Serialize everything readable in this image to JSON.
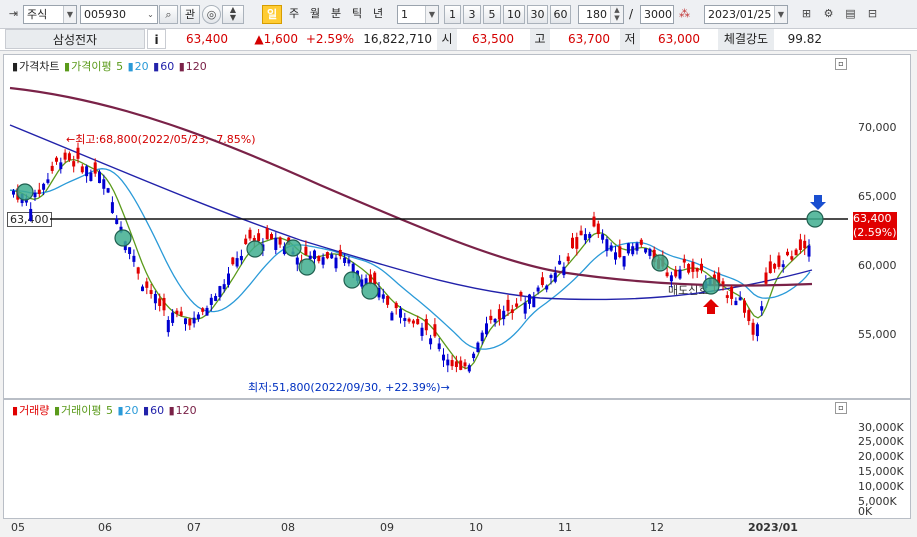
{
  "toolbar": {
    "market": "주식",
    "code": "005930",
    "kwan_label": "관",
    "period_buttons": [
      "일",
      "주",
      "월",
      "분",
      "틱",
      "년"
    ],
    "active_period": "일",
    "interval_value": "1",
    "interval_buttons": [
      "1",
      "3",
      "5",
      "10",
      "30",
      "60"
    ],
    "display_count": "180",
    "total_count": "3000",
    "date": "2023/01/25",
    "separator": "/"
  },
  "quote": {
    "name": "삼성전자",
    "info_btn": "i",
    "price": "63,400",
    "change": "▲1,600",
    "change_pct": "+2.59%",
    "volume": "16,822,710",
    "open_label": "시",
    "open": "63,500",
    "high_label": "고",
    "high": "63,700",
    "low_label": "저",
    "low": "63,000",
    "strength_label": "체결강도",
    "strength": "99.82"
  },
  "price_panel": {
    "legend": {
      "title": "가격차트",
      "ma_label": "가격이평",
      "ma5": "5",
      "ma20": "20",
      "ma60": "60",
      "ma120": "120"
    },
    "y_ticks": [
      "70,000",
      "65,000",
      "60,000",
      "55,000"
    ],
    "hline_label": "63,400",
    "last_price_label": "63,400",
    "last_pct_label": "(2.59%)",
    "high_annotation": "←최고:68,800(2022/05/23, -7.85%)",
    "low_annotation": "최저:51,800(2022/09/30, +22.39%)→",
    "mid_label": "매도신호",
    "colors": {
      "up": "#e00000",
      "down": "#0000d0",
      "ma5": "#5a9a1a",
      "ma20": "#2a9ad8",
      "ma60": "#2222aa",
      "ma120": "#7a2248"
    }
  },
  "volume_panel": {
    "legend": {
      "title": "거래량",
      "ma_label": "거래이평",
      "ma5": "5",
      "ma20": "20",
      "ma60": "60",
      "ma120": "120"
    },
    "y_ticks": [
      "30,000K",
      "25,000K",
      "20,000K",
      "15,000K",
      "10,000K",
      "5,000K",
      "0K"
    ]
  },
  "x_labels": [
    "05",
    "06",
    "07",
    "08",
    "09",
    "10",
    "11",
    "12",
    "2023/01"
  ]
}
